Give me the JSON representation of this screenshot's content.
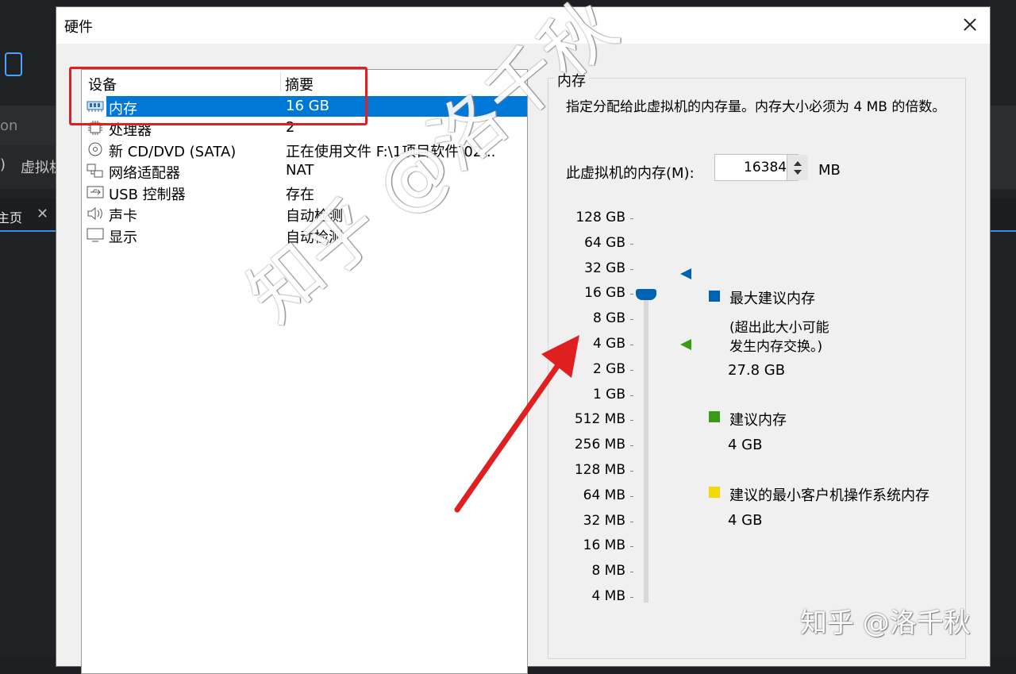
{
  "background": {
    "items": [
      "on",
      ")",
      "虚拟机",
      "主页"
    ]
  },
  "dialog": {
    "title": "硬件",
    "devices": {
      "headers": {
        "device": "设备",
        "summary": "摘要"
      },
      "rows": [
        {
          "icon": "memory-icon",
          "name": "内存",
          "summary": "16 GB",
          "selected": true
        },
        {
          "icon": "processor-icon",
          "name": "处理器",
          "summary": "2"
        },
        {
          "icon": "cd-dvd-icon",
          "name": "新 CD/DVD (SATA)",
          "summary": "正在使用文件 F:\\1项目软件\\02..."
        },
        {
          "icon": "network-adapter-icon",
          "name": "网络适配器",
          "summary": "NAT"
        },
        {
          "icon": "usb-icon",
          "name": "USB 控制器",
          "summary": "存在"
        },
        {
          "icon": "sound-card-icon",
          "name": "声卡",
          "summary": "自动检测"
        },
        {
          "icon": "display-icon",
          "name": "显示",
          "summary": "自动检测"
        }
      ]
    },
    "memory": {
      "group_title": "内存",
      "description": "指定分配给此虚拟机的内存量。内存大小必须为 4 MB 的倍数。",
      "label": "此虚拟机的内存(M):",
      "value": "16384",
      "unit": "MB",
      "scale": [
        "128 GB",
        "64 GB",
        "32 GB",
        "16 GB",
        "8 GB",
        "4 GB",
        "2 GB",
        "1 GB",
        "512 MB",
        "256 MB",
        "128 MB",
        "64 MB",
        "32 MB",
        "16 MB",
        "8 MB",
        "4 MB"
      ],
      "slider_value": "16 GB",
      "legend": {
        "max": {
          "label": "最大建议内存",
          "note1": "(超出此大小可能",
          "note2": "发生内存交换。)",
          "value": "27.8 GB",
          "color": "#0063b1"
        },
        "recommended": {
          "label": "建议内存",
          "value": "4 GB",
          "color": "#3a9a1a"
        },
        "min_guest": {
          "label": "建议的最小客户机操作系统内存",
          "value": "4 GB",
          "color": "#f5d800"
        }
      }
    }
  },
  "watermark": {
    "large": "知乎 @洛千秋",
    "corner": "知乎 @洛千秋"
  }
}
